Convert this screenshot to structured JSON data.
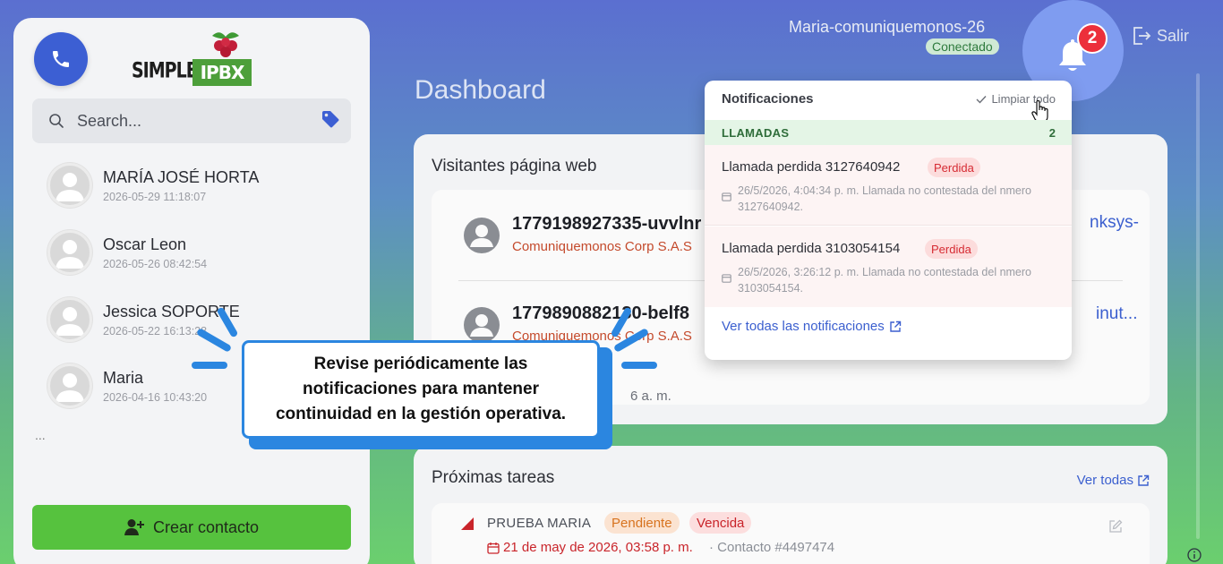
{
  "brand": {
    "simple": "SIMPLE",
    "ipbx": "IPBX"
  },
  "search": {
    "placeholder": "Search..."
  },
  "contacts": [
    {
      "name": "MARÍA JOSÉ HORTA",
      "date": "2026-05-29 11:18:07"
    },
    {
      "name": "Oscar Leon",
      "date": "2026-05-26 08:42:54"
    },
    {
      "name": "Jessica SOPORTE",
      "date": "2026-05-22 16:13:28"
    },
    {
      "name": "Maria",
      "date": "2026-04-16 10:43:20"
    }
  ],
  "contacts_more": "...",
  "create_contact_label": "Crear contacto",
  "header": {
    "user": "Maria-comuniquemonos-26",
    "status": "Conectado",
    "notification_count": "2",
    "logout_label": "Salir"
  },
  "page_title": "Dashboard",
  "visitors": {
    "title": "Visitantes página web",
    "items": [
      {
        "id": "1779198927335-uvvlnr",
        "company": "Comuniquemonos Corp S.A.S",
        "link": "nksys-"
      },
      {
        "id": "1779890882130-belf8",
        "company": "Comuniquemonos Corp S.A.S",
        "link": "inut..."
      }
    ],
    "time_fragment": "6 a. m."
  },
  "tasks": {
    "title": "Próximas tareas",
    "view_all": "Ver todas",
    "items": [
      {
        "name": "PRUEBA MARIA",
        "status": "Pendiente",
        "overdue": "Vencida",
        "date": "21 de may de 2026, 03:58 p. m.",
        "contact": "· Contacto #4497474"
      }
    ]
  },
  "notifications": {
    "title": "Notificaciones",
    "clear_all": "Limpiar todo",
    "section": "LLAMADAS",
    "section_count": "2",
    "items": [
      {
        "title": "Llamada perdida 3127640942",
        "badge": "Perdida",
        "description": "26/5/2026, 4:04:34 p. m. Llamada no contestada del nmero 3127640942."
      },
      {
        "title": "Llamada perdida 3103054154",
        "badge": "Perdida",
        "description": "26/5/2026, 3:26:12 p. m. Llamada no contestada del nmero 3103054154."
      }
    ],
    "view_all": "Ver todas las notificaciones"
  },
  "tip": {
    "text": "Revise periódicamente las notificaciones para mantener continuidad en la gestión operativa."
  },
  "colors": {
    "accent_blue": "#3c5fd3",
    "success_green": "#56c23e",
    "danger_red": "#ec2f3b",
    "callout_blue": "#2b86e0"
  }
}
